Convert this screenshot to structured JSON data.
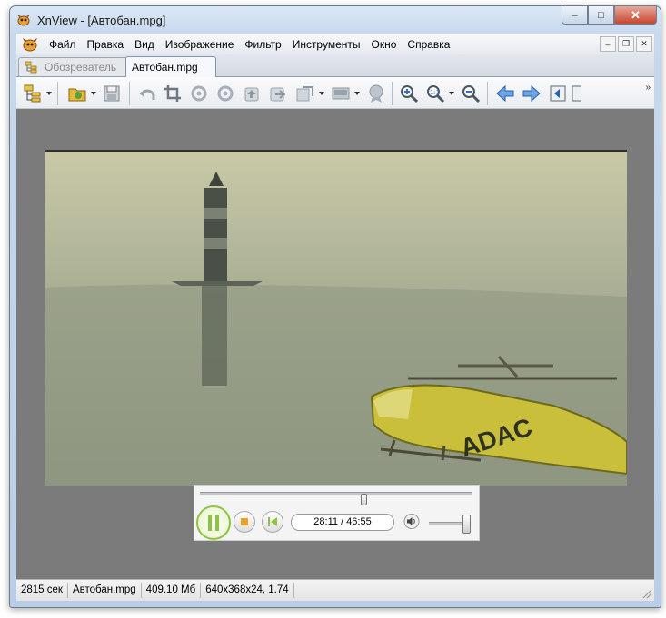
{
  "window": {
    "title": "XnView - [Автобан.mpg]"
  },
  "caption_buttons": {
    "minimize": "–",
    "maximize": "□",
    "close": "✕"
  },
  "menu": [
    "Файл",
    "Правка",
    "Вид",
    "Изображение",
    "Фильтр",
    "Инструменты",
    "Окно",
    "Справка"
  ],
  "mdi_buttons": {
    "minimize": "–",
    "restore": "❐",
    "close": "✕"
  },
  "tabs": [
    {
      "label": "Обозреватель",
      "active": false
    },
    {
      "label": "Автобан.mpg",
      "active": true
    }
  ],
  "toolbar": {
    "buttons": [
      "tree-view-icon",
      "folder-browse-icon",
      "save-icon",
      "undo-icon",
      "crop-icon",
      "rotate-left-icon",
      "rotate-right-icon",
      "previous-folder-icon",
      "open-icon",
      "convert-icon",
      "slideshow-icon",
      "settings-badge-icon",
      "zoom-in-icon",
      "zoom-actual-icon",
      "zoom-out-icon",
      "previous-icon",
      "next-icon",
      "first-page-icon",
      "last-page-icon"
    ],
    "overflow": "»"
  },
  "player": {
    "time": "28:11 / 46:55",
    "seek_fraction": 0.6,
    "volume_fraction": 1.0,
    "video_text": "ADAC"
  },
  "status": [
    "2815 сек",
    "Автобан.mpg",
    "409.10 Мб",
    "640x368x24, 1.74"
  ],
  "colors": {
    "accent": "#8cc63f",
    "viewer_bg": "#7b7b7b"
  }
}
